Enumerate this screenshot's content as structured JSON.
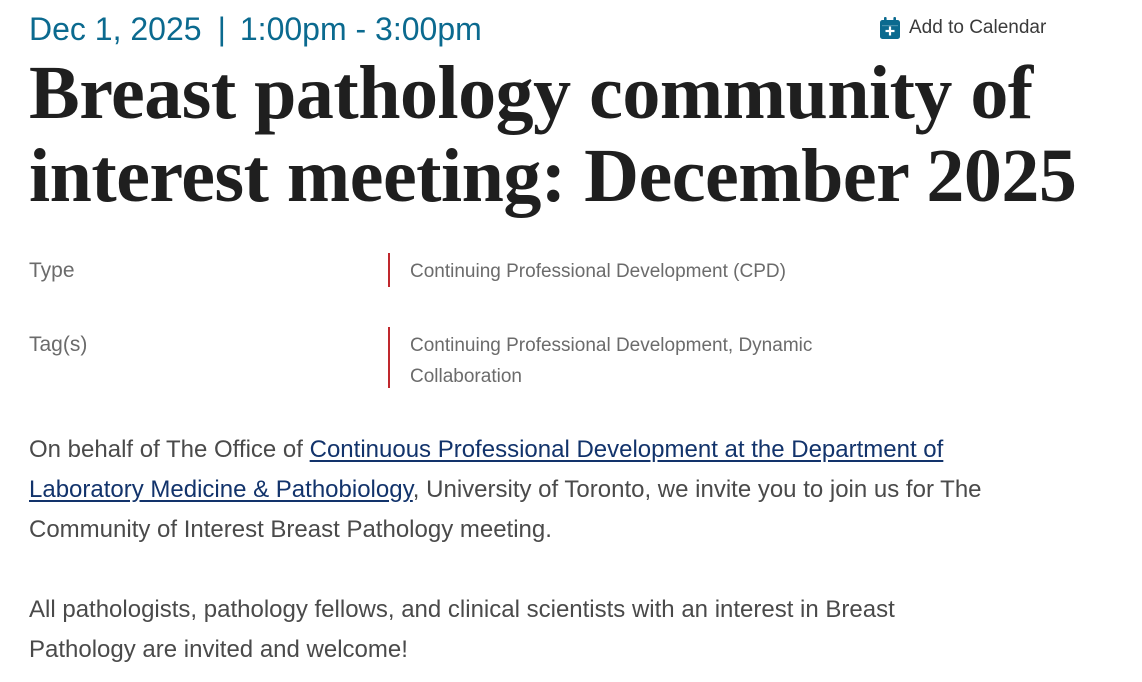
{
  "event": {
    "date": "Dec 1, 2025",
    "separator": "|",
    "time": "1:00pm - 3:00pm",
    "add_to_calendar": {
      "label": "Add to Calendar",
      "icon": "calendar-plus-icon",
      "icon_color": "#0b6a8f"
    },
    "title": "Breast pathology community of interest meeting: December 2025",
    "meta": {
      "type_label": "Type",
      "type_value": "Continuing Professional Development (CPD)",
      "tags_label": "Tag(s)",
      "tags_value": "Continuing Professional Development, Dynamic Collaboration"
    },
    "description": {
      "p1_prefix": "On behalf of The Office of ",
      "p1_link": "Continuous Professional Development at the Department of Laboratory Medicine & Pathobiology",
      "p1_suffix": ", University of Toronto, we invite you to join us for The Community of Interest Breast Pathology meeting.",
      "p2": "All pathologists, pathology fellows, and clinical scientists with an interest in Breast Pathology are invited and welcome!"
    }
  },
  "colors": {
    "accent": "#0b6a8f",
    "title": "#1f1f1f",
    "divider": "#c0282d",
    "link": "#12336b",
    "body_text": "#4a4a4a",
    "meta_text": "#6b6b6b"
  }
}
